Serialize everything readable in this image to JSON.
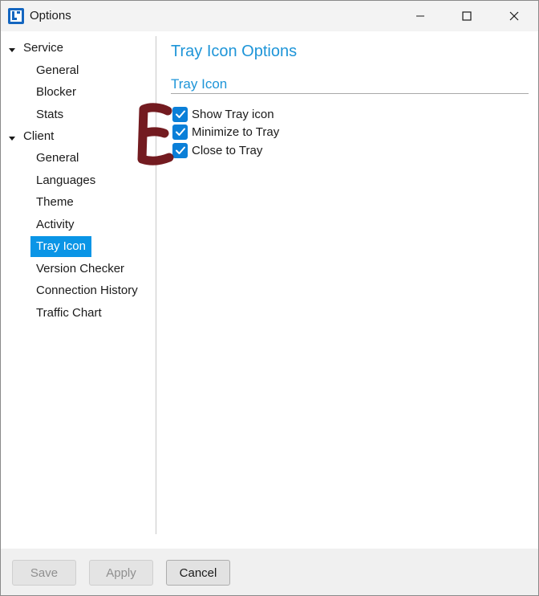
{
  "window": {
    "title": "Options"
  },
  "nav": {
    "groups": [
      {
        "label": "Service",
        "expanded": true,
        "items": [
          "General",
          "Blocker",
          "Stats"
        ]
      },
      {
        "label": "Client",
        "expanded": true,
        "items": [
          "General",
          "Languages",
          "Theme",
          "Activity",
          "Tray Icon",
          "Version Checker",
          "Connection History",
          "Traffic Chart"
        ]
      }
    ],
    "selected": "Tray Icon"
  },
  "content": {
    "title": "Tray Icon Options",
    "group_header": "Tray Icon",
    "options": [
      {
        "label": "Show Tray icon",
        "checked": true
      },
      {
        "label": "Minimize to Tray",
        "checked": true
      },
      {
        "label": "Close to Tray",
        "checked": true
      }
    ]
  },
  "footer": {
    "save_label": "Save",
    "apply_label": "Apply",
    "cancel_label": "Cancel",
    "save_enabled": false,
    "apply_enabled": false,
    "cancel_enabled": true
  },
  "colors": {
    "accent": "#1e95d8",
    "selection": "#0a95e6",
    "checkbox": "#0a7fd8",
    "annotation": "#6b0f14"
  },
  "icons": {
    "app": "app-logo-icon",
    "minimize": "minimize-icon",
    "maximize": "maximize-icon",
    "close": "close-icon",
    "expander": "chevron-down-icon",
    "check": "checkmark-icon"
  }
}
